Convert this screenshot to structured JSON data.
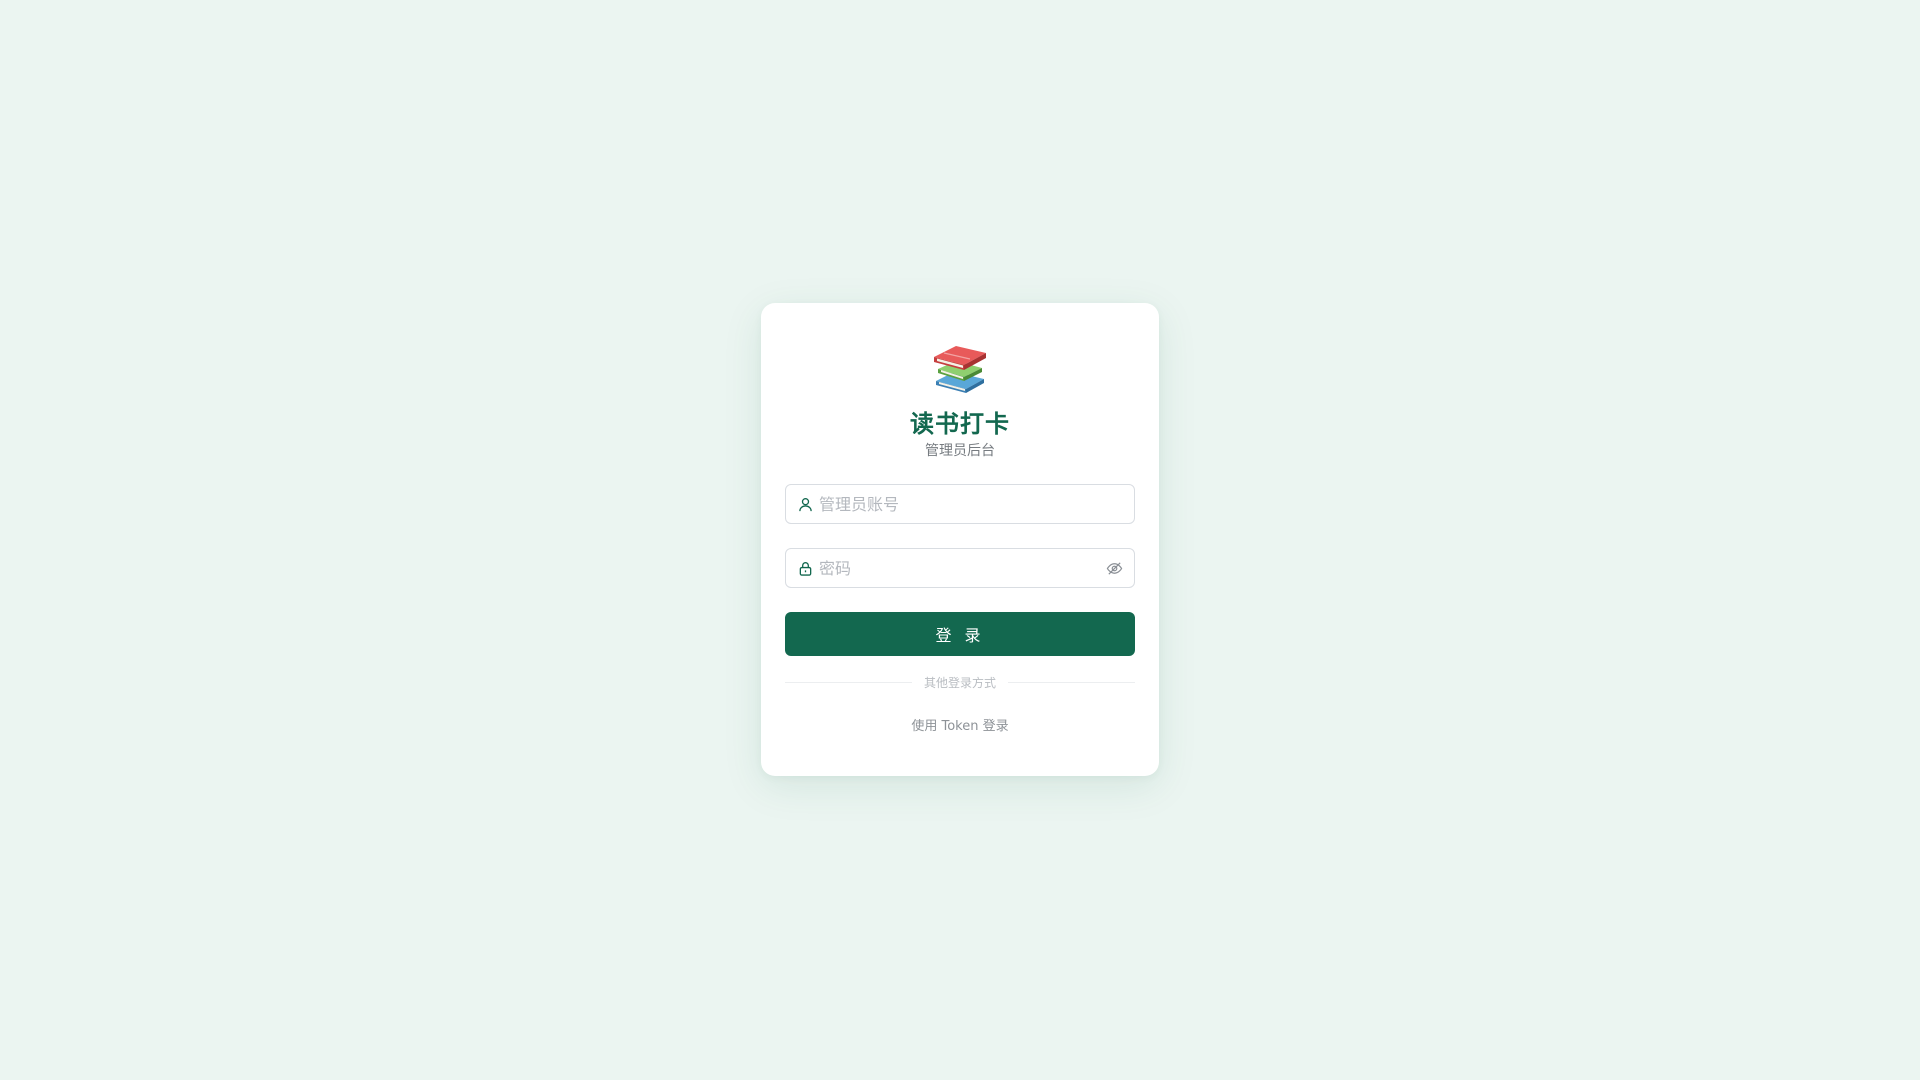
{
  "brand": {
    "logo_icon": "books-stack-icon",
    "title": "读书打卡",
    "subtitle": "管理员后台"
  },
  "form": {
    "username": {
      "placeholder": "管理员账号",
      "value": "",
      "icon": "user-icon"
    },
    "password": {
      "placeholder": "密码",
      "value": "",
      "icon": "lock-icon",
      "toggle_icon": "eye-off-icon"
    },
    "submit_label": "登 录"
  },
  "divider_text": "其他登录方式",
  "token_login_label": "使用 Token 登录",
  "colors": {
    "background": "#ebf5f1",
    "primary": "#13684f",
    "card": "#ffffff"
  }
}
